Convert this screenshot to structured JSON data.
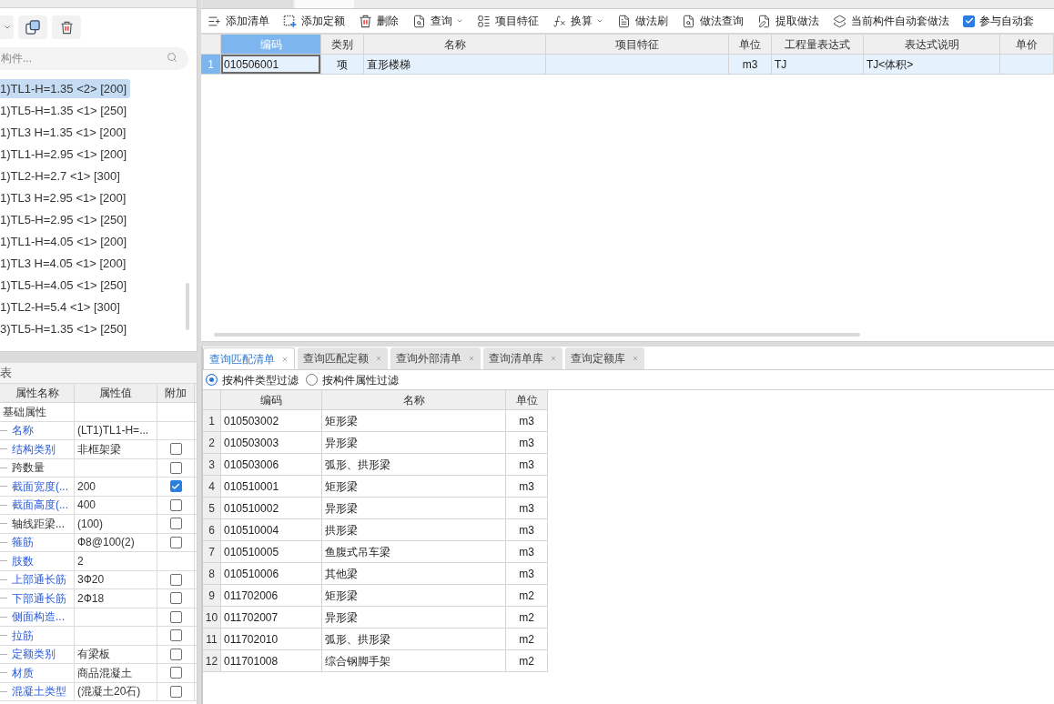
{
  "component_list": {
    "search": {
      "placeholder": "构件..."
    },
    "items": [
      {
        "label": "1)TL1-H=1.35 <2> [200]",
        "selected": true
      },
      {
        "label": "1)TL5-H=1.35 <1> [250]",
        "selected": false
      },
      {
        "label": "1)TL3 H=1.35 <1> [200]",
        "selected": false
      },
      {
        "label": "1)TL1-H=2.95 <1> [200]",
        "selected": false
      },
      {
        "label": "1)TL2-H=2.7 <1> [300]",
        "selected": false
      },
      {
        "label": "1)TL3 H=2.95 <1> [200]",
        "selected": false
      },
      {
        "label": "1)TL5-H=2.95 <1> [250]",
        "selected": false
      },
      {
        "label": "1)TL1-H=4.05 <1> [200]",
        "selected": false
      },
      {
        "label": "1)TL3 H=4.05 <1> [200]",
        "selected": false
      },
      {
        "label": "1)TL5-H=4.05 <1> [250]",
        "selected": false
      },
      {
        "label": "1)TL2-H=5.4 <1> [300]",
        "selected": false
      },
      {
        "label": "3)TL5-H=1.35 <1> [250]",
        "selected": false
      }
    ]
  },
  "property_panel": {
    "title": "表",
    "columns": [
      "属性名称",
      "属性值",
      "附加"
    ],
    "rows": [
      {
        "kind": "group",
        "name": "基础属性"
      },
      {
        "kind": "field",
        "name": "名称",
        "public": true,
        "value": "(LT1)TL1-H=..."
      },
      {
        "kind": "check",
        "name": "结构类别",
        "public": true,
        "value": "非框架梁",
        "checked": false
      },
      {
        "kind": "check",
        "name": "跨数量",
        "public": false,
        "checked": false
      },
      {
        "kind": "check",
        "name": "截面宽度(...",
        "public": true,
        "value": "200",
        "checked": true
      },
      {
        "kind": "check",
        "name": "截面高度(...",
        "public": true,
        "value": "400",
        "checked": false
      },
      {
        "kind": "check",
        "name": "轴线距梁...",
        "public": false,
        "value": "(100)",
        "checked": false
      },
      {
        "kind": "check",
        "name": "箍筋",
        "public": true,
        "value": "Ф8@100(2)",
        "checked": false
      },
      {
        "kind": "field",
        "name": "肢数",
        "public": true,
        "value": "2"
      },
      {
        "kind": "check",
        "name": "上部通长筋",
        "public": true,
        "value": "3Ф20",
        "checked": false
      },
      {
        "kind": "check",
        "name": "下部通长筋",
        "public": true,
        "value": "2Ф18",
        "checked": false
      },
      {
        "kind": "check",
        "name": "侧面构造...",
        "public": true,
        "checked": false
      },
      {
        "kind": "check",
        "name": "拉筋",
        "public": true,
        "checked": false
      },
      {
        "kind": "check",
        "name": "定额类别",
        "public": true,
        "value": "有梁板",
        "checked": false
      },
      {
        "kind": "check",
        "name": "材质",
        "public": true,
        "value": "商品混凝土",
        "checked": false
      },
      {
        "kind": "check",
        "name": "混凝土类型",
        "public": true,
        "value": "(混凝土20石)",
        "checked": false
      }
    ]
  },
  "method_panel": {
    "tabs": [
      {
        "selected": false
      },
      {
        "selected": true
      }
    ],
    "toolbar": [
      {
        "kind": "button",
        "label": "添加清单",
        "dropdown": false
      },
      {
        "kind": "button",
        "label": "添加定额",
        "dropdown": false
      },
      {
        "kind": "button",
        "label": "删除",
        "dropdown": false
      },
      {
        "kind": "button",
        "label": "查询",
        "dropdown": true
      },
      {
        "kind": "button",
        "label": "项目特征",
        "dropdown": false
      },
      {
        "kind": "button",
        "label": "换算",
        "dropdown": true
      },
      {
        "kind": "button",
        "label": "做法刷",
        "dropdown": false
      },
      {
        "kind": "button",
        "label": "做法查询",
        "dropdown": false
      },
      {
        "kind": "button",
        "label": "提取做法",
        "dropdown": false
      },
      {
        "kind": "button",
        "label": "当前构件自动套做法",
        "dropdown": false
      },
      {
        "kind": "checkbox",
        "label": "参与自动套",
        "checked": true
      }
    ],
    "table": {
      "columns": [
        {
          "label": "编码",
          "selected": true
        },
        {
          "label": "类别",
          "selected": false
        },
        {
          "label": "名称",
          "selected": false
        },
        {
          "label": "项目特征",
          "selected": false
        },
        {
          "label": "单位",
          "selected": false
        },
        {
          "label": "工程量表达式",
          "selected": false
        },
        {
          "label": "表达式说明",
          "selected": false
        },
        {
          "label": "单价",
          "selected": false
        }
      ],
      "rows": [
        {
          "number": "1",
          "selected": true,
          "cells": [
            "010506001",
            "项",
            "直形楼梯",
            null,
            "m3",
            "TJ",
            "TJ<体积>",
            null
          ]
        }
      ]
    }
  },
  "query_panel": {
    "tabs": [
      {
        "label": "查询匹配清单",
        "selected": true
      },
      {
        "label": "查询匹配定额",
        "selected": false
      },
      {
        "label": "查询外部清单",
        "selected": false
      },
      {
        "label": "查询清单库",
        "selected": false
      },
      {
        "label": "查询定额库",
        "selected": false
      }
    ],
    "filters": [
      {
        "label": "按构件类型过滤",
        "selected": true
      },
      {
        "label": "按构件属性过滤",
        "selected": false
      }
    ],
    "table": {
      "columns": [
        "编码",
        "名称",
        "单位"
      ],
      "rows": [
        {
          "number": "1",
          "cells": [
            "010503002",
            "矩形梁",
            "m3"
          ]
        },
        {
          "number": "2",
          "cells": [
            "010503003",
            "异形梁",
            "m3"
          ]
        },
        {
          "number": "3",
          "cells": [
            "010503006",
            "弧形、拱形梁",
            "m3"
          ]
        },
        {
          "number": "4",
          "cells": [
            "010510001",
            "矩形梁",
            "m3"
          ]
        },
        {
          "number": "5",
          "cells": [
            "010510002",
            "异形梁",
            "m3"
          ]
        },
        {
          "number": "6",
          "cells": [
            "010510004",
            "拱形梁",
            "m3"
          ]
        },
        {
          "number": "7",
          "cells": [
            "010510005",
            "鱼腹式吊车梁",
            "m3"
          ]
        },
        {
          "number": "8",
          "cells": [
            "010510006",
            "其他梁",
            "m3"
          ]
        },
        {
          "number": "9",
          "cells": [
            "011702006",
            "矩形梁",
            "m2"
          ]
        },
        {
          "number": "10",
          "cells": [
            "011702007",
            "异形梁",
            "m2"
          ]
        },
        {
          "number": "11",
          "cells": [
            "011702010",
            "弧形、拱形梁",
            "m2"
          ]
        },
        {
          "number": "12",
          "cells": [
            "011701008",
            "综合钢脚手架",
            "m2"
          ]
        }
      ]
    }
  }
}
